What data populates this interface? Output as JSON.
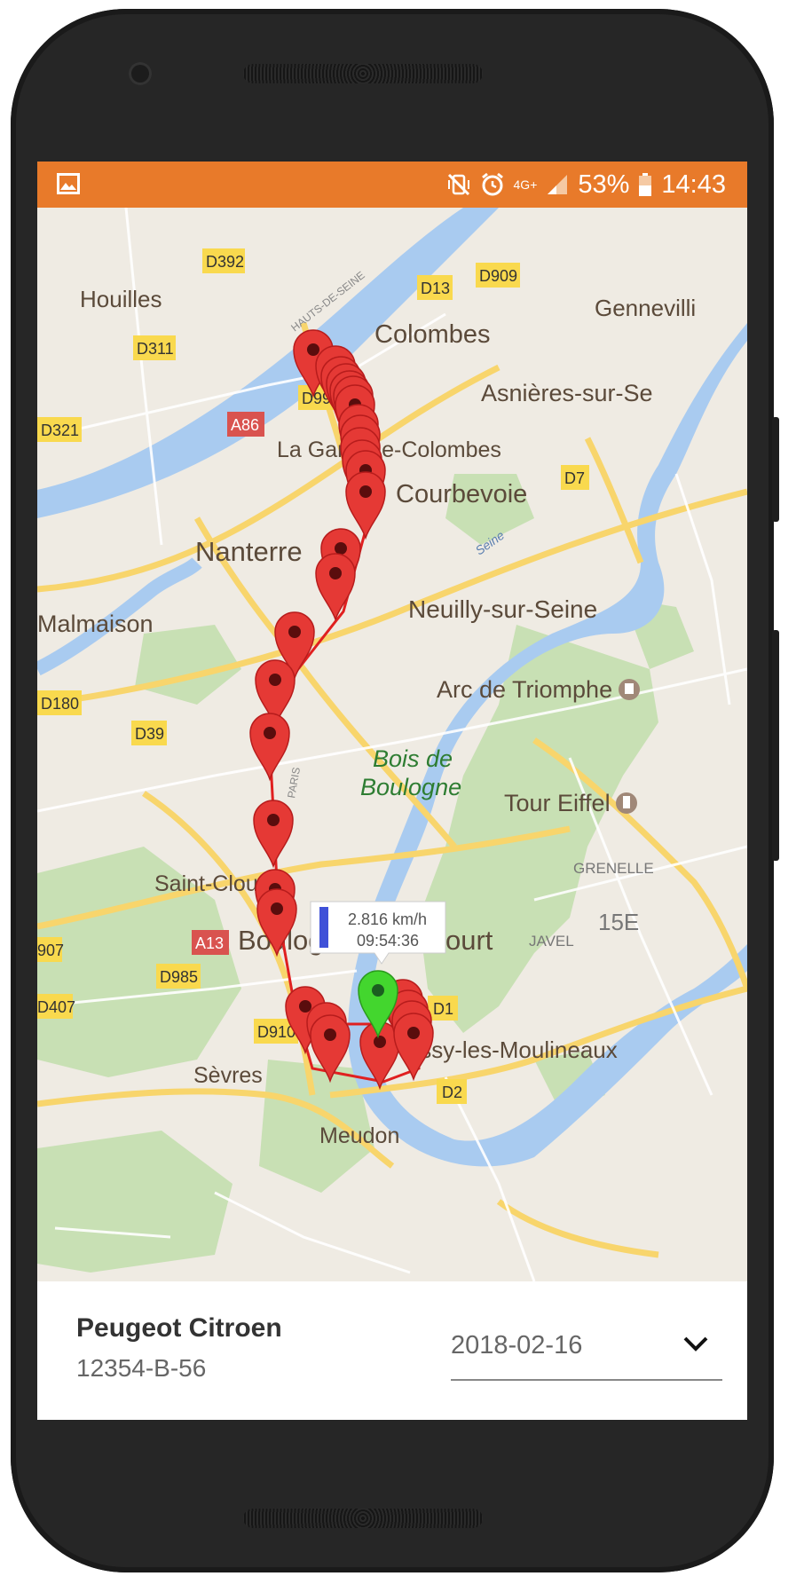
{
  "status_bar": {
    "left_icon": "image-notification-icon",
    "network": "4G+",
    "battery": "53%",
    "time": "14:43",
    "icons": [
      "mute-vibrate-icon",
      "alarm-icon",
      "signal-icon",
      "battery-icon"
    ]
  },
  "map": {
    "places": {
      "houilles": "Houilles",
      "colombes": "Colombes",
      "gennevilliers": "Gennevilli",
      "asnieres": "Asnières-sur-Se",
      "la_garenne": "La Garenne-Colombes",
      "courbevoie": "Courbevoie",
      "nanterre": "Nanterre",
      "neuilly": "Neuilly-sur-Seine",
      "malmaison": "Malmaison",
      "arc": "Arc de Triomphe",
      "bois1": "Bois de",
      "bois2": "Boulogne",
      "tour": "Tour Eiffel",
      "grenelle": "GRENELLE",
      "quinze": "15E",
      "javel": "JAVEL",
      "saint_cloud": "Saint-Cloud",
      "boulogne": "Boulogne",
      "court": "ourt",
      "issy": "Issy-les-Moulineaux",
      "sevres": "Sèvres",
      "meudon": "Meudon",
      "hauts_de_seine": "HAUTS-DE-SEINE",
      "seine": "Seine",
      "paris": "PARIS"
    },
    "roads": {
      "d392": "D392",
      "d13": "D13",
      "d909": "D909",
      "d311": "D311",
      "d992": "D992",
      "a86": "A86",
      "d321": "D321",
      "d7": "D7",
      "d180": "D180",
      "d39": "D39",
      "a13": "A13",
      "d985": "D985",
      "d907": "907",
      "d407": "D407",
      "d910": "D910",
      "d1": "D1",
      "d2": "D2"
    },
    "info_window": {
      "speed": "2.816 km/h",
      "time": "09:54:36",
      "accent": "#3f51d8"
    },
    "route_color": "#e02020",
    "marker_color": "#e53935",
    "current_marker_color": "#43d62e"
  },
  "vehicle": {
    "name": "Peugeot Citroen",
    "plate": "12354-B-56"
  },
  "date_select": {
    "value": "2018-02-16"
  },
  "theme": {
    "status_bar_color": "#e87a2a"
  }
}
